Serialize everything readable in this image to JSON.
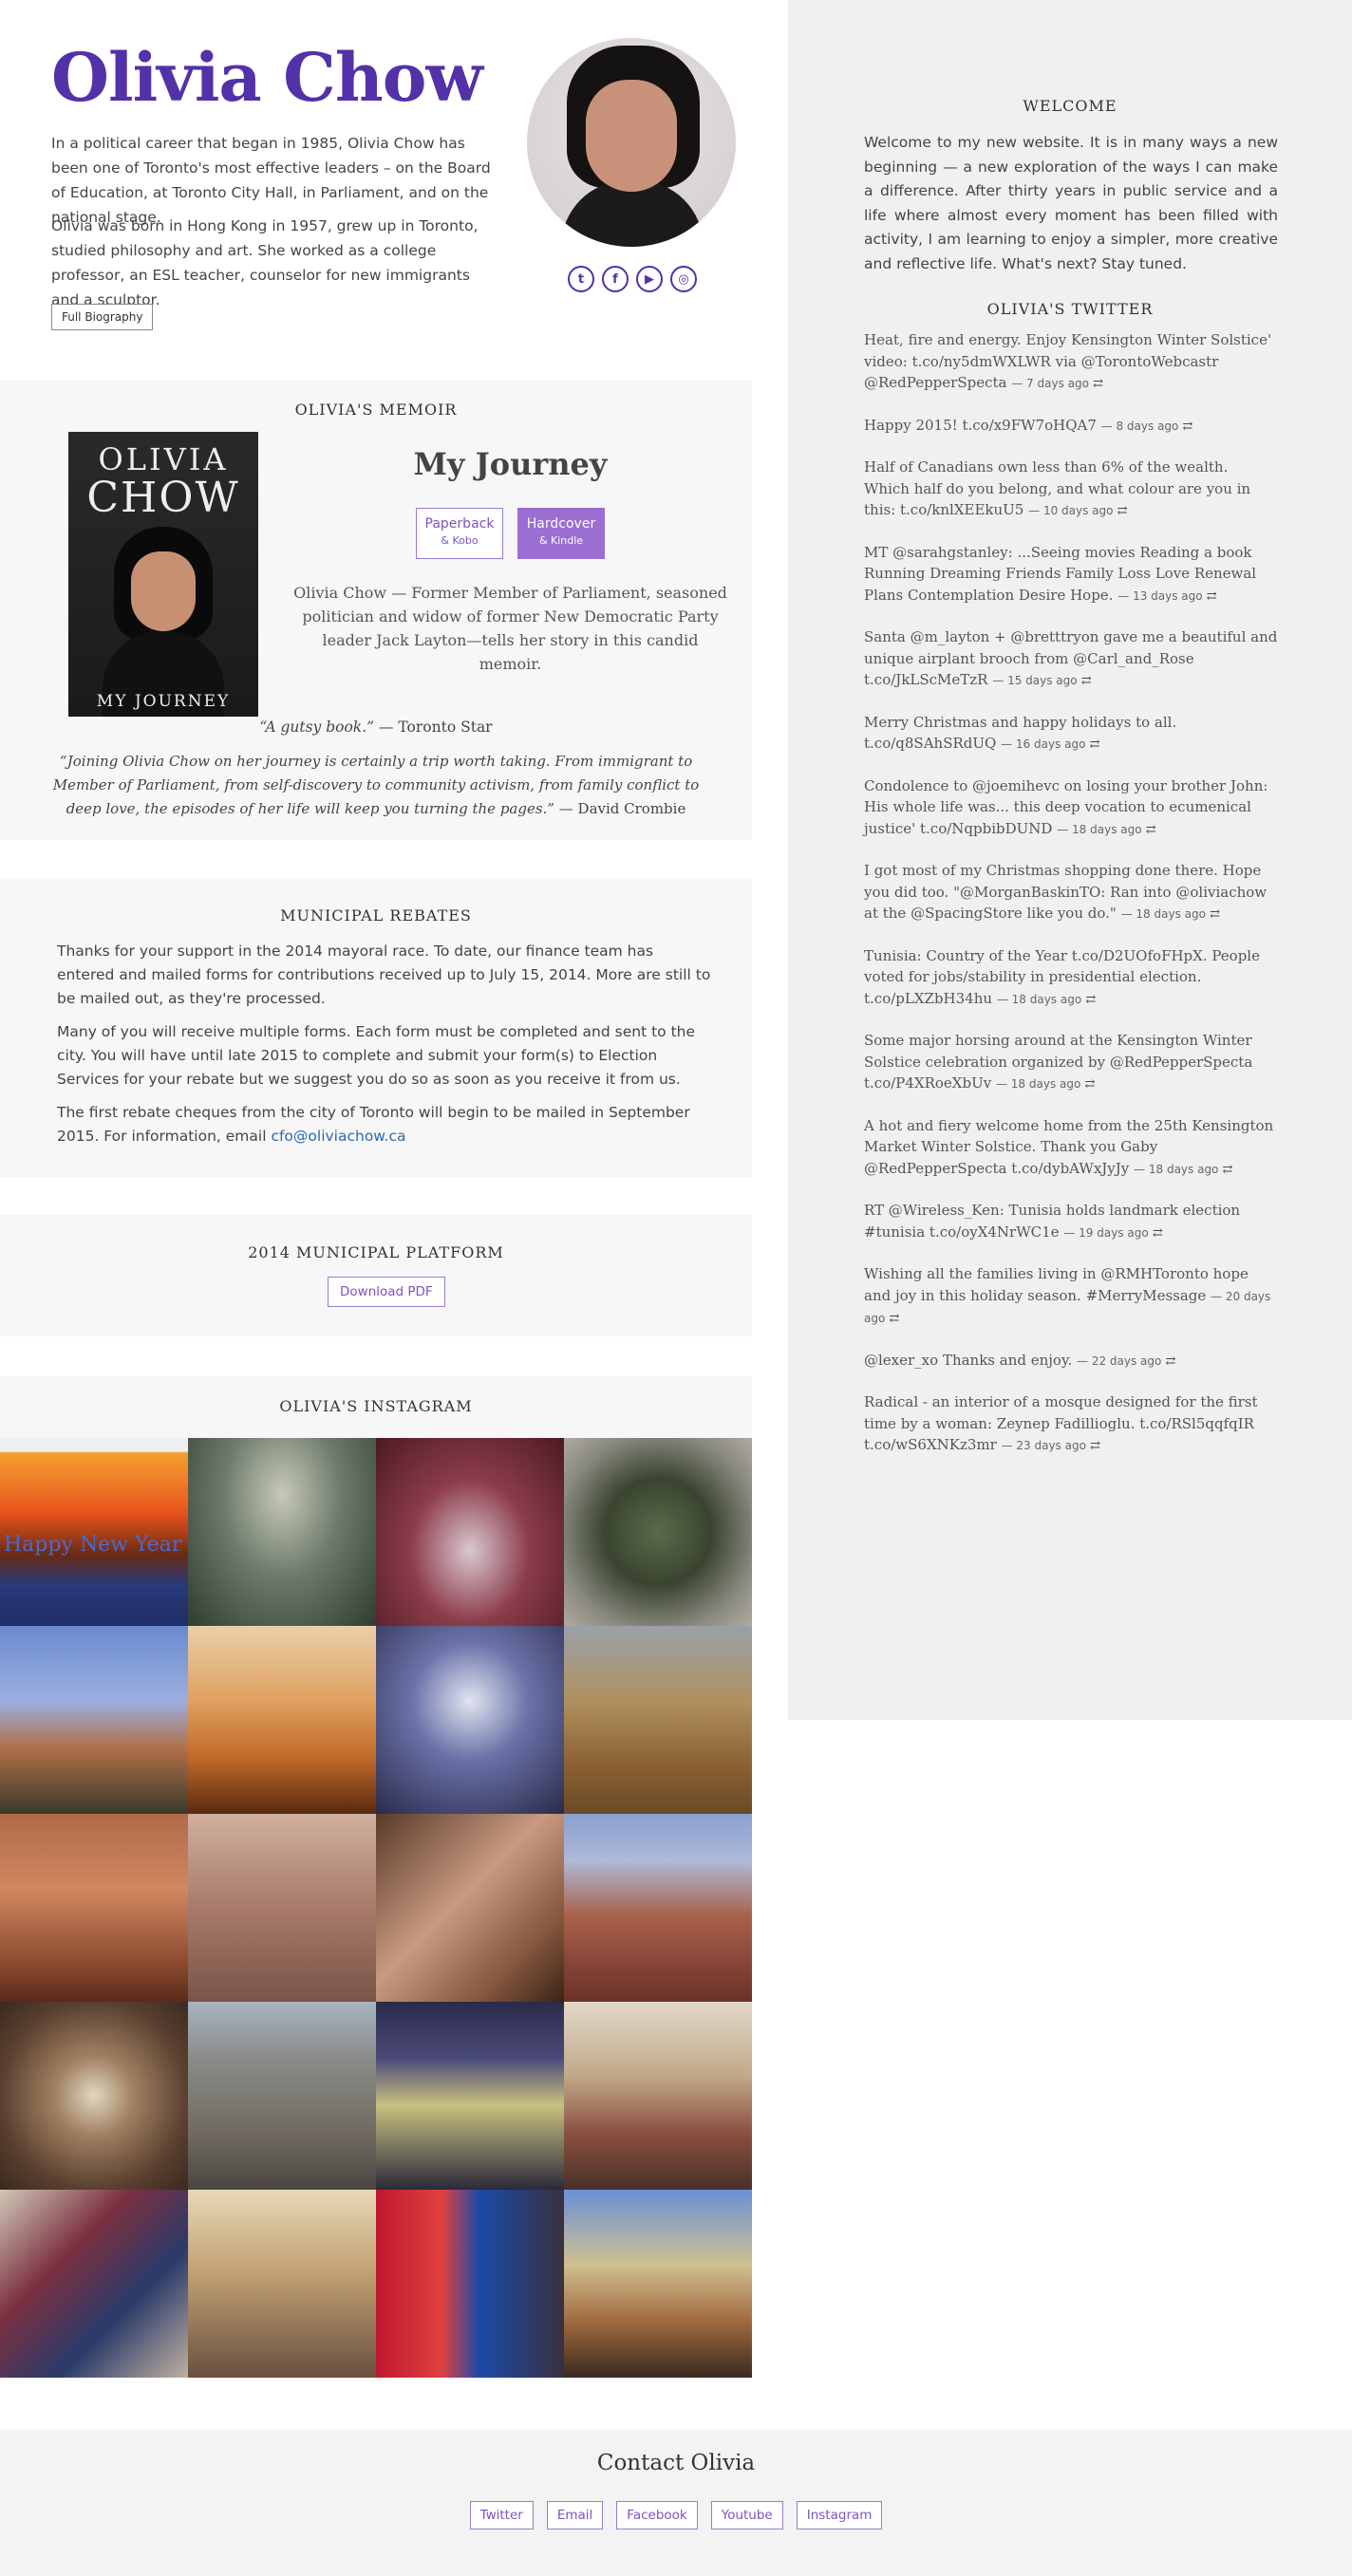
{
  "hero": {
    "name": "Olivia Chow",
    "bio1": "In a political career that began in 1985, Olivia Chow has been one of Toronto's most effective leaders – on the Board of Education, at Toronto City Hall, in Parliament, and on the national stage.",
    "bio2": "Olivia was born in Hong Kong in 1957, grew up in Toronto, studied philosophy and art. She worked as a college professor, an ESL teacher, counselor for new immigrants and a sculptor.",
    "bio_button": "Full Biography",
    "social_icons": [
      "twitter-icon",
      "facebook-icon",
      "youtube-icon",
      "instagram-icon"
    ]
  },
  "memoir": {
    "heading": "OLIVIA'S MEMOIR",
    "cover_line1": "OLIVIA",
    "cover_line2": "CHOW",
    "cover_line3": "MY JOURNEY",
    "title": "My Journey",
    "paperback": "Paperback",
    "paperback_sub": "& Kobo",
    "hardcover": "Hardcover",
    "hardcover_sub": "& Kindle",
    "description": "Olivia Chow — Former Member of Parliament, seasoned politician and widow of former New Democratic Party leader Jack Layton—tells her story in this candid memoir.",
    "quote1": "“A gutsy book.”",
    "quote1_source": " — Toronto Star",
    "quote2": "“Joining Olivia Chow on her journey is certainly a trip worth taking. From immigrant to Member of Parliament, from self-discovery to community activism, from family conflict to deep love, the episodes of her life will keep you turning the pages.”",
    "quote2_source": " — David Crombie"
  },
  "rebates": {
    "heading": "MUNICIPAL REBATES",
    "p1": "Thanks for your support in the 2014 mayoral race. To date, our finance team has entered and mailed forms for contributions received up to July 15, 2014. More are still to be mailed out, as they're processed.",
    "p2": "Many of you will receive multiple forms. Each form must be completed and sent to the city. You will have until late 2015 to complete and submit your form(s) to Election Services for your rebate but we suggest you do so as soon as you receive it from us.",
    "p3": "The first rebate cheques from the city of Toronto will begin to be mailed in September 2015. For information, email ",
    "email": "cfo@oliviachow.ca"
  },
  "platform": {
    "heading": "2014 MUNICIPAL PLATFORM",
    "download": "Download PDF"
  },
  "instagram": {
    "heading": "OLIVIA'S INSTAGRAM",
    "first_tile_text": "Happy New Year"
  },
  "welcome": {
    "heading": "WELCOME",
    "text": "Welcome to my new website. It is in many ways a new beginning — a new exploration of the ways I can make a difference. After thirty years in public service and a life where almost every moment has been filled with activity, I am learning to enjoy a simpler, more creative and reflective life. What's next? Stay tuned."
  },
  "twitter": {
    "heading": "OLIVIA'S TWITTER",
    "tweets": [
      {
        "text": "Heat, fire and energy. Enjoy Kensington Winter Solstice' video: t.co/ny5dmWXLWR via @TorontoWebcastr @RedPepperSpecta",
        "meta": "— 7 days ago"
      },
      {
        "text": "Happy 2015! t.co/x9FW7oHQA7",
        "meta": "— 8 days ago"
      },
      {
        "text": "Half of Canadians own less than 6% of the wealth. Which half do you belong, and what colour are you in this: t.co/knlXEEkuU5",
        "meta": "— 10 days ago"
      },
      {
        "text": "MT @sarahgstanley: ...Seeing movies Reading a book Running Dreaming Friends Family Loss Love Renewal Plans Contemplation Desire Hope.",
        "meta": "— 13 days ago"
      },
      {
        "text": "Santa @m_layton + @bretttryon gave me a beautiful and unique airplant brooch from @Carl_and_Rose t.co/JkLScMeTzR",
        "meta": "— 15 days ago"
      },
      {
        "text": "Merry Christmas and happy holidays to all. t.co/q8SAhSRdUQ",
        "meta": "— 16 days ago"
      },
      {
        "text": "Condolence to @joemihevc on losing your brother John: His whole life was... this deep vocation to ecumenical justice' t.co/NqpbibDUND",
        "meta": "— 18 days ago"
      },
      {
        "text": "I got most of my Christmas shopping done there. Hope you did too. \"@MorganBaskinTO: Ran into @oliviachow at the @SpacingStore like you do.\"",
        "meta": "— 18 days ago"
      },
      {
        "text": "Tunisia: Country of the Year t.co/D2UOfoFHpX. People voted for jobs/stability in presidential election. t.co/pLXZbH34hu",
        "meta": "— 18 days ago"
      },
      {
        "text": "Some major horsing around at the Kensington Winter Solstice celebration organized by @RedPepperSpecta t.co/P4XRoeXbUv",
        "meta": "— 18 days ago"
      },
      {
        "text": "A hot and fiery welcome home from the 25th Kensington Market Winter Solstice. Thank you Gaby @RedPepperSpecta t.co/dybAWxJyJy",
        "meta": "— 18 days ago"
      },
      {
        "text": "RT @Wireless_Ken: Tunisia holds landmark election #tunisia t.co/oyX4NrWC1e",
        "meta": "— 19 days ago"
      },
      {
        "text": "Wishing all the families living in @RMHToronto hope and joy in this holiday season. #MerryMessage",
        "meta": "— 20 days ago"
      },
      {
        "text": "@lexer_xo Thanks and enjoy.",
        "meta": "— 22 days ago"
      },
      {
        "text": "Radical - an interior of a mosque designed for the first time by a woman: Zeynep Fadillioglu. t.co/RSl5qqfqIR t.co/wS6XNKz3mr",
        "meta": "— 23 days ago"
      }
    ],
    "retweet_icon": "retweet-icon"
  },
  "footer": {
    "heading": "Contact Olivia",
    "links": [
      "Twitter",
      "Email",
      "Facebook",
      "Youtube",
      "Instagram"
    ]
  },
  "colors": {
    "brand_purple": "#5331a8",
    "button_purple": "#9b6ed2",
    "link_blue": "#2a6bb0"
  }
}
